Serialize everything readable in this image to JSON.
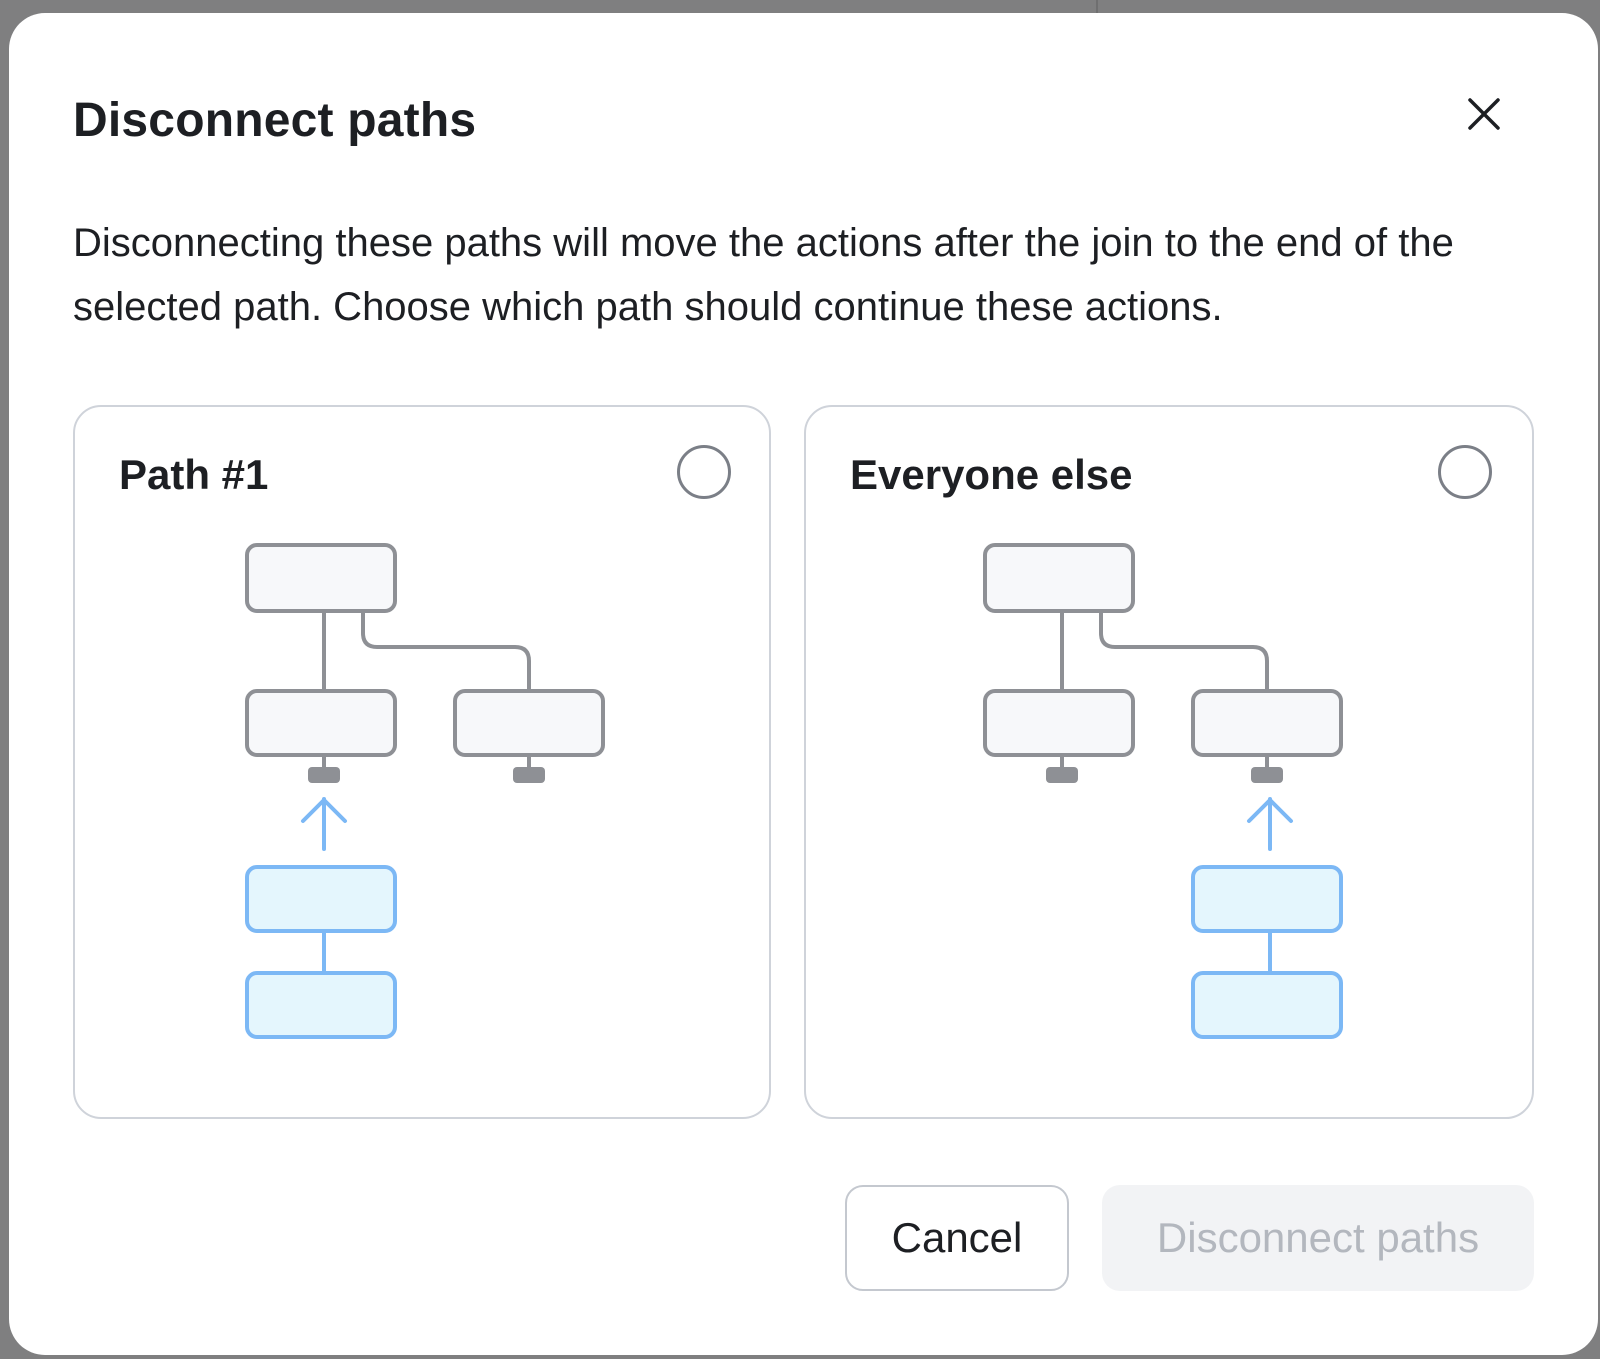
{
  "dialog": {
    "title": "Disconnect paths",
    "description": "Disconnecting these paths will move the actions after the join to the end of the selected path. Choose which path should continue these actions.",
    "close_icon": "close-icon"
  },
  "options": [
    {
      "label": "Path #1",
      "selected": false
    },
    {
      "label": "Everyone else",
      "selected": false
    }
  ],
  "buttons": {
    "cancel_label": "Cancel",
    "confirm_label": "Disconnect paths",
    "confirm_enabled": false
  },
  "colors": {
    "node_fill": "#f7f8fa",
    "node_stroke": "#8e9095",
    "moved_fill": "#e4f6fd",
    "moved_stroke": "#7cb8f5",
    "disabled_text": "#b3b7be"
  }
}
